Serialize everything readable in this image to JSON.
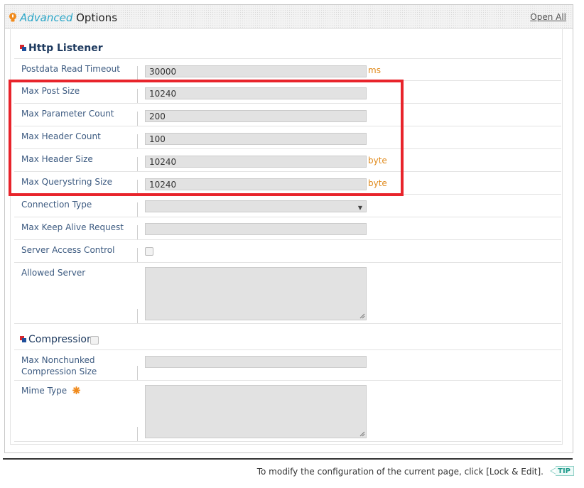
{
  "header": {
    "title_accent": "Advanced",
    "title_main": " Options",
    "open_all": "Open All"
  },
  "http_listener": {
    "title": "Http Listener",
    "rows": {
      "postdata_timeout": {
        "label": "Postdata Read Timeout",
        "value": "30000",
        "unit": "ms"
      },
      "max_post_size": {
        "label": "Max Post Size",
        "value": "10240"
      },
      "max_parameter_count": {
        "label": "Max Parameter Count",
        "value": "200"
      },
      "max_header_count": {
        "label": "Max Header Count",
        "value": "100"
      },
      "max_header_size": {
        "label": "Max Header Size",
        "value": "10240",
        "unit": "byte"
      },
      "max_querystring_size": {
        "label": "Max Querystring Size",
        "value": "10240",
        "unit": "byte"
      },
      "connection_type": {
        "label": "Connection Type",
        "value": ""
      },
      "max_keep_alive": {
        "label": "Max Keep Alive Request",
        "value": ""
      },
      "server_access_control": {
        "label": "Server Access Control",
        "checked": false
      },
      "allowed_server": {
        "label": "Allowed Server",
        "value": ""
      }
    }
  },
  "compression": {
    "title": "Compression",
    "enabled": false,
    "rows": {
      "max_nonchunked": {
        "label_line1": "Max Nonchunked",
        "label_line2": "Compression Size",
        "value": ""
      },
      "mime_type": {
        "label": "Mime Type",
        "value": ""
      }
    }
  },
  "footer": {
    "text": "To modify the configuration of the current page, click [Lock & Edit].",
    "tip": "TIP"
  },
  "colors": {
    "accent": "#2aa6c8",
    "label": "#3c5a80",
    "unit": "#e08a1c",
    "highlight": "#e8242b"
  }
}
